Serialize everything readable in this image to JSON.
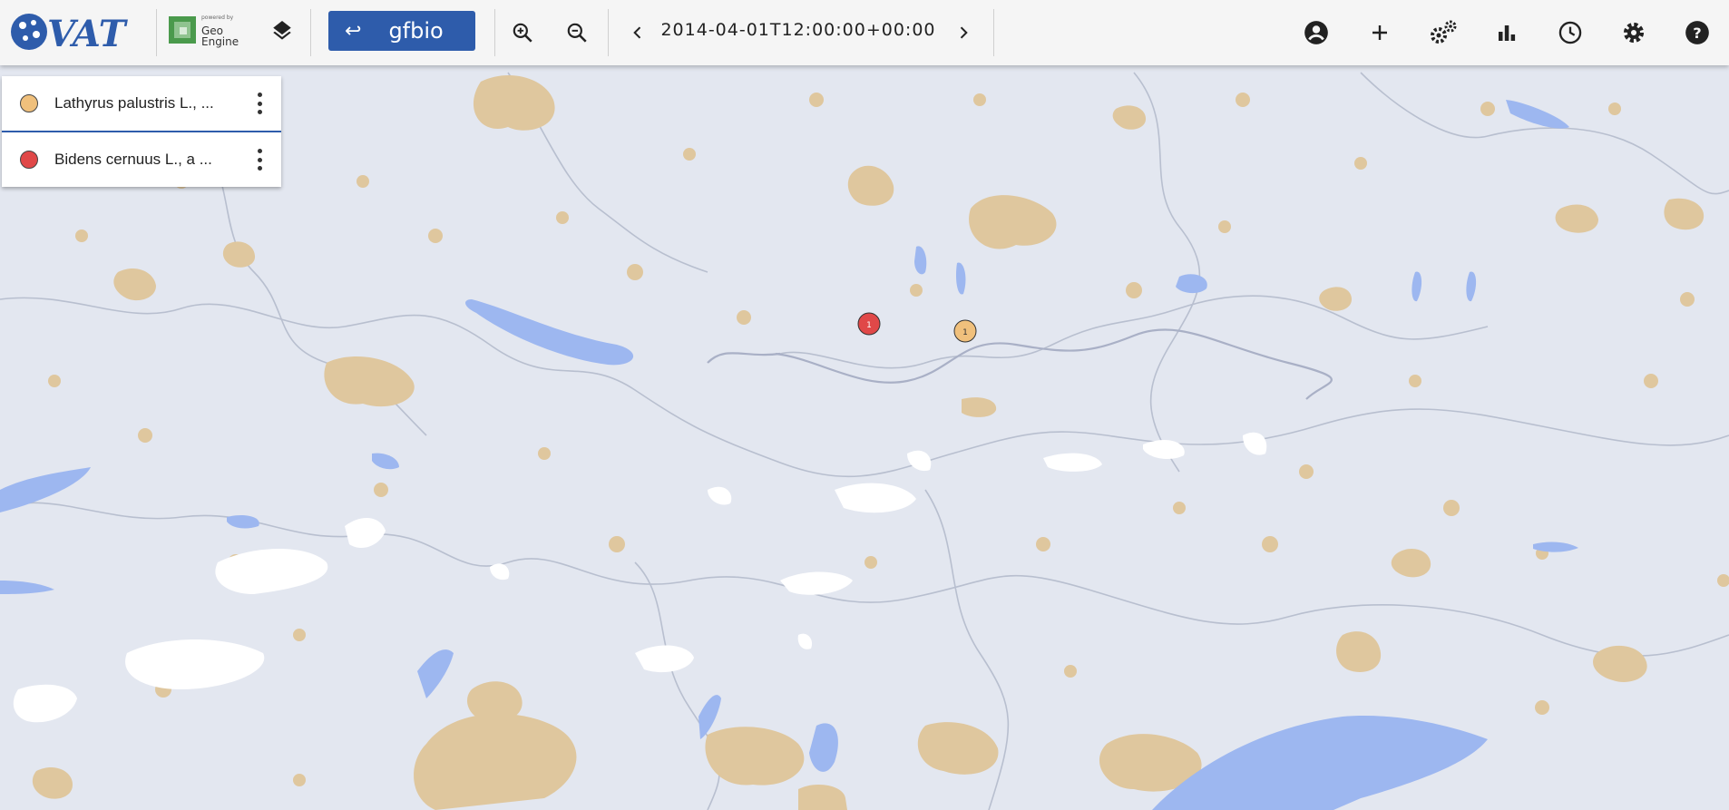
{
  "app": {
    "logo_text": "VAT",
    "powered_by": "powered by",
    "engine_name": "Geo Engine"
  },
  "toolbar": {
    "gfbio_label": "gfbio",
    "time": "2014-04-01T12:00:00+00:00",
    "icons": [
      "layers-icon",
      "zoom-in-icon",
      "zoom-out-icon",
      "chevron-left-icon",
      "chevron-right-icon",
      "account-icon",
      "plus-icon",
      "operators-icon",
      "chart-icon",
      "clock-icon",
      "settings-icon",
      "help-icon"
    ]
  },
  "layers": [
    {
      "name": "Lathyrus palustris L., ...",
      "color": "#f0c07c"
    },
    {
      "name": "Bidens cernuus L., a ...",
      "color": "#e04848"
    }
  ],
  "markers": [
    {
      "label": "1",
      "color": "#e04848"
    },
    {
      "label": "1",
      "color": "#f0c07c"
    }
  ],
  "colors": {
    "accent": "#2e5cab",
    "water": "#9db7f0",
    "urban": "#dfc79e",
    "land": "#e3e7f0",
    "snow": "#ffffff"
  }
}
